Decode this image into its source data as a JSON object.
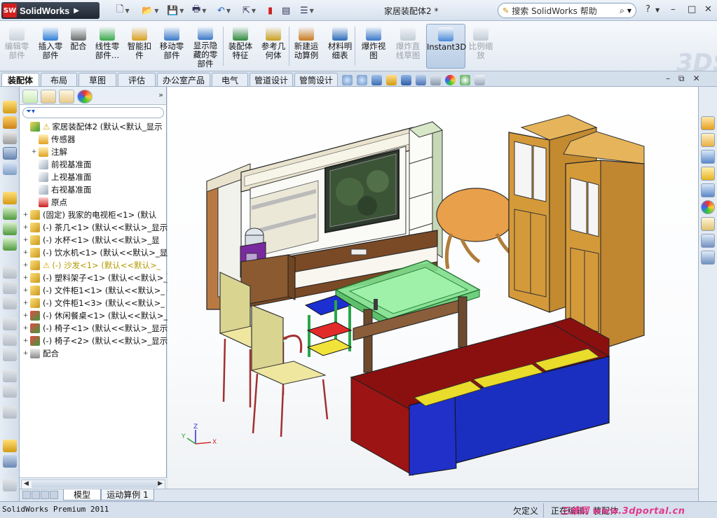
{
  "app": {
    "name": "SolidWorks",
    "logo_badge": "SW"
  },
  "document_title": "家居装配体2 *",
  "help_search": {
    "label": "搜索 SolidWorks 帮助"
  },
  "title_controls": [
    "?",
    "–",
    "□"
  ],
  "command_manager": [
    {
      "label": "编辑零\n部件",
      "enabled": false,
      "icon": "edit-component-icon"
    },
    {
      "label": "插入零\n部件",
      "enabled": true,
      "icon": "insert-component-icon"
    },
    {
      "label": "配合",
      "enabled": true,
      "icon": "mate-icon"
    },
    {
      "label": "线性零\n部件…",
      "enabled": true,
      "icon": "linear-pattern-icon"
    },
    {
      "label": "智能扣\n件",
      "enabled": true,
      "icon": "smart-fastener-icon"
    },
    {
      "label": "移动零\n部件",
      "enabled": true,
      "icon": "move-component-icon"
    },
    {
      "label": "显示隐\n藏的零\n部件",
      "enabled": true,
      "icon": "show-hidden-icon"
    },
    {
      "label": "装配体\n特征",
      "enabled": true,
      "icon": "assembly-feature-icon"
    },
    {
      "label": "参考几\n何体",
      "enabled": true,
      "icon": "reference-geometry-icon"
    },
    {
      "label": "新建运\n动算例",
      "enabled": true,
      "icon": "motion-study-icon"
    },
    {
      "label": "材料明\n细表",
      "enabled": true,
      "icon": "bom-icon"
    },
    {
      "label": "爆炸视\n图",
      "enabled": true,
      "icon": "exploded-view-icon"
    },
    {
      "label": "爆炸直\n线草图",
      "enabled": false,
      "icon": "explode-line-icon"
    },
    {
      "label": "Instant3D",
      "enabled": true,
      "active": true,
      "icon": "instant3d-icon"
    },
    {
      "label": "比例缩\n放",
      "enabled": false,
      "icon": "scale-icon"
    }
  ],
  "tabs": [
    "装配体",
    "布局",
    "草图",
    "评估",
    "办公室产品",
    "电气",
    "管道设计",
    "管筒设计"
  ],
  "selected_tab": "装配体",
  "feature_tree": [
    {
      "label": "家居装配体2  (默认<默认_显示",
      "icon": "assembly-icon",
      "expander": "",
      "warning": true,
      "indent": 0
    },
    {
      "label": "传感器",
      "icon": "sensor-icon",
      "expander": "",
      "indent": 1
    },
    {
      "label": "注解",
      "icon": "annotation-icon",
      "expander": "+",
      "indent": 1
    },
    {
      "label": "前视基准面",
      "icon": "plane-icon",
      "expander": "",
      "indent": 1
    },
    {
      "label": "上视基准面",
      "icon": "plane-icon",
      "expander": "",
      "indent": 1
    },
    {
      "label": "右视基准面",
      "icon": "plane-icon",
      "expander": "",
      "indent": 1
    },
    {
      "label": "原点",
      "icon": "origin-icon",
      "expander": "",
      "indent": 1
    },
    {
      "label": "(固定) 我家的电视柜<1>  (默认",
      "icon": "part-icon",
      "expander": "+",
      "indent": 0
    },
    {
      "label": "(-) 茶几<1>  (默认<<默认>_显示",
      "icon": "part-icon",
      "expander": "+",
      "indent": 0
    },
    {
      "label": "(-) 水杯<1>  (默认<<默认>_显",
      "icon": "part-icon",
      "expander": "+",
      "indent": 0
    },
    {
      "label": "(-) 饮水机<1>  (默认<<默认>_显",
      "icon": "part-icon",
      "expander": "+",
      "indent": 0
    },
    {
      "label": "(-) 沙发<1>  (默认<<默认>_",
      "icon": "part-icon",
      "expander": "+",
      "warning": true,
      "indent": 0
    },
    {
      "label": "(-) 塑料架子<1>  (默认<<默认>_",
      "icon": "part-icon",
      "expander": "+",
      "indent": 0
    },
    {
      "label": "(-) 文件柜1<1>  (默认<<默认>_",
      "icon": "part-icon",
      "expander": "+",
      "indent": 0
    },
    {
      "label": "(-) 文件柜1<3>  (默认<<默认>_",
      "icon": "part-icon",
      "expander": "+",
      "indent": 0
    },
    {
      "label": "(-) 休闲餐桌<1>  (默认<<默认>_",
      "icon": "subassembly-icon",
      "expander": "+",
      "indent": 0
    },
    {
      "label": "(-) 椅子<1>  (默认<<默认>_显示",
      "icon": "subassembly-icon",
      "expander": "+",
      "indent": 0
    },
    {
      "label": "(-) 椅子<2>  (默认<<默认>_显示",
      "icon": "subassembly-icon",
      "expander": "+",
      "indent": 0
    },
    {
      "label": "配合",
      "icon": "mates-folder-icon",
      "expander": "+",
      "indent": 0
    }
  ],
  "bottom_tabs": [
    "模型",
    "运动算例 1"
  ],
  "status": {
    "left": "SolidWorks Premium 2011",
    "undefined": "欠定义",
    "editing": "正在编辑：装配体"
  },
  "watermark": "三维网 www.3dportal.cn",
  "triad_labels": [
    "Z",
    "X",
    "Y"
  ],
  "colors": {
    "accent": "#2b5fa8",
    "sofa_body": "#8a1010",
    "sofa_blue": "#1a2fbf",
    "sofa_yellow": "#e9dc2a",
    "cabinet": "#d49a3a",
    "glass": "#7fe08c"
  }
}
